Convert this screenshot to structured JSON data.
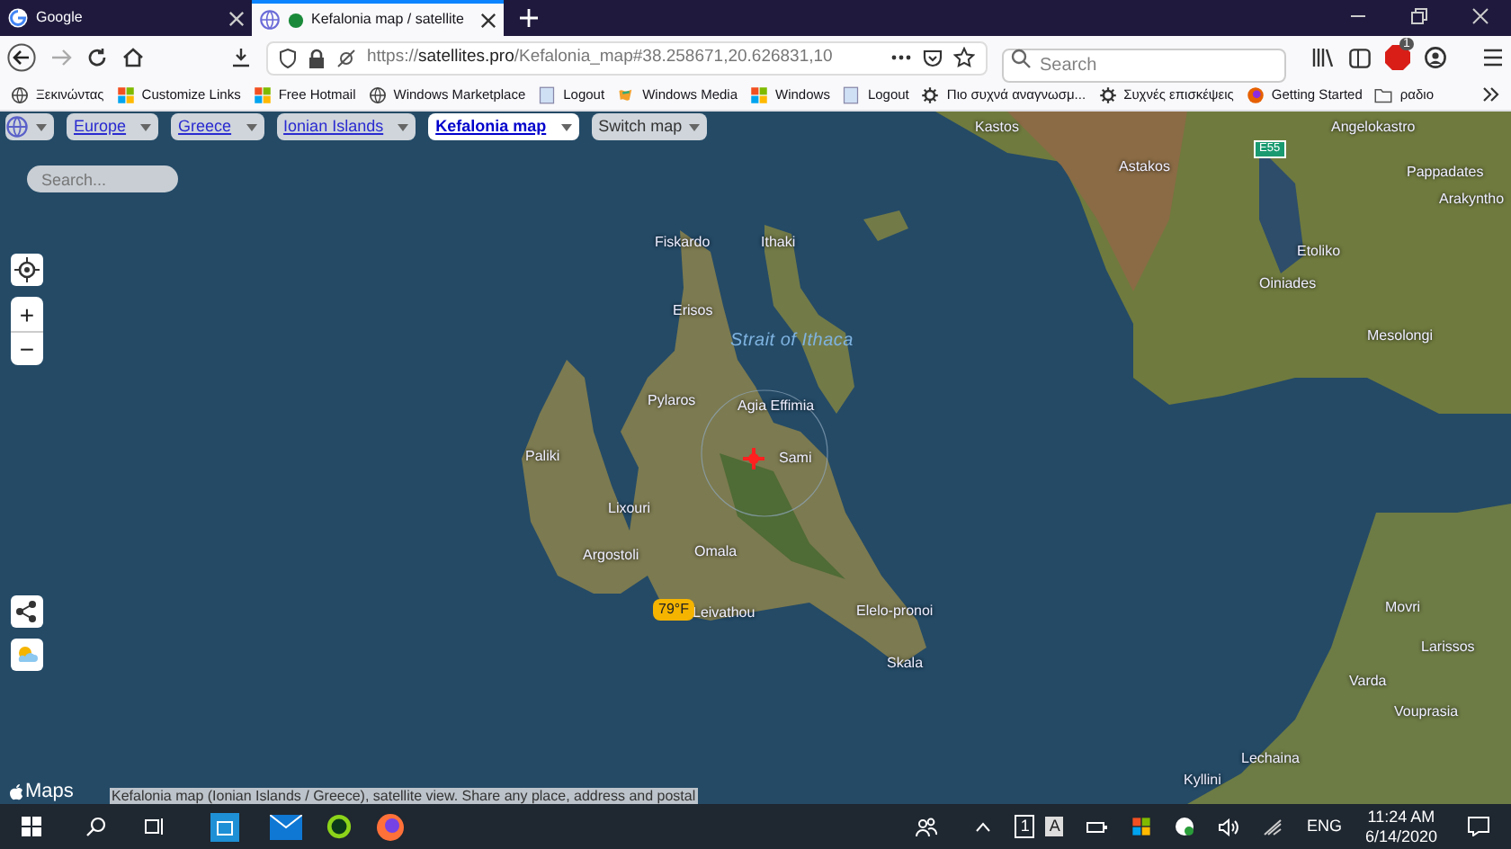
{
  "browser_tabs": [
    {
      "title": "Google",
      "selected": false
    },
    {
      "title": "Kefalonia map / satellite",
      "selected": true
    }
  ],
  "address_bar": {
    "url": "https://**satellites.pro**/Kefalonia_map#38.258671,20.626831,10"
  },
  "search_field": {
    "placeholder": "Search"
  },
  "addon_badge": "1",
  "bookmarks": [
    {
      "label": "Ξεκινώντας",
      "kind": "globe"
    },
    {
      "label": "Customize Links",
      "kind": "windows"
    },
    {
      "label": "Free Hotmail",
      "kind": "windows"
    },
    {
      "label": "Windows Marketplace",
      "kind": "globe"
    },
    {
      "label": "Logout",
      "kind": "page"
    },
    {
      "label": "Windows Media",
      "kind": "flag"
    },
    {
      "label": "Windows",
      "kind": "windows"
    },
    {
      "label": "Logout",
      "kind": "page"
    },
    {
      "label": "Πιο συχνά αναγνωσμ...",
      "kind": "gear"
    },
    {
      "label": "Συχνές επισκέψεις",
      "kind": "gear"
    },
    {
      "label": "Getting Started",
      "kind": "firefox"
    },
    {
      "label": "ραδιο",
      "kind": "folder"
    }
  ],
  "breadcrumb": [
    {
      "label": "Europe",
      "selected": false
    },
    {
      "label": "Greece",
      "selected": false
    },
    {
      "label": "Ionian Islands",
      "selected": false
    },
    {
      "label": "Kefalonia map",
      "selected": true
    }
  ],
  "switch_map": "Switch map",
  "map_search": {
    "placeholder": "Search..."
  },
  "zoom_in": "+",
  "zoom_out": "−",
  "map_labels": [
    {
      "text": "Kastos",
      "kind": "place"
    },
    {
      "text": "Astakos",
      "kind": "place"
    },
    {
      "text": "Angelokastro",
      "kind": "place"
    },
    {
      "text": "Pappadates",
      "kind": "place"
    },
    {
      "text": "Arakyntho",
      "kind": "place"
    },
    {
      "text": "Etoliko",
      "kind": "place"
    },
    {
      "text": "Oiniades",
      "kind": "place"
    },
    {
      "text": "Mesolongi",
      "kind": "place"
    },
    {
      "text": "Fiskardo",
      "kind": "place"
    },
    {
      "text": "Ithaki",
      "kind": "place"
    },
    {
      "text": "Erisos",
      "kind": "place"
    },
    {
      "text": "Strait of Ithaca",
      "kind": "water"
    },
    {
      "text": "Pylaros",
      "kind": "place"
    },
    {
      "text": "Agia Effimia",
      "kind": "place"
    },
    {
      "text": "Sami",
      "kind": "place"
    },
    {
      "text": "Paliki",
      "kind": "place"
    },
    {
      "text": "Lixouri",
      "kind": "place"
    },
    {
      "text": "Argostoli",
      "kind": "place"
    },
    {
      "text": "Omala",
      "kind": "place"
    },
    {
      "text": "Leivathou",
      "kind": "place"
    },
    {
      "text": "Elelo-pronoi",
      "kind": "place"
    },
    {
      "text": "Skala",
      "kind": "place"
    },
    {
      "text": "Movri",
      "kind": "place"
    },
    {
      "text": "Larissos",
      "kind": "place"
    },
    {
      "text": "Varda",
      "kind": "place"
    },
    {
      "text": "Vouprasia",
      "kind": "place"
    },
    {
      "text": "Lechaina",
      "kind": "place"
    },
    {
      "text": "Kyllini",
      "kind": "place"
    },
    {
      "text": "E55",
      "kind": "road"
    }
  ],
  "weather_badge": "79°F",
  "attribution": "Maps",
  "caption": "Kefalonia map (Ionian Islands / Greece), satellite view. Share any place, address and postal",
  "taskbar": {
    "language": "ENG",
    "time": "11:24 AM",
    "date": "6/14/2020",
    "tray_badges": [
      "1",
      "A"
    ]
  }
}
